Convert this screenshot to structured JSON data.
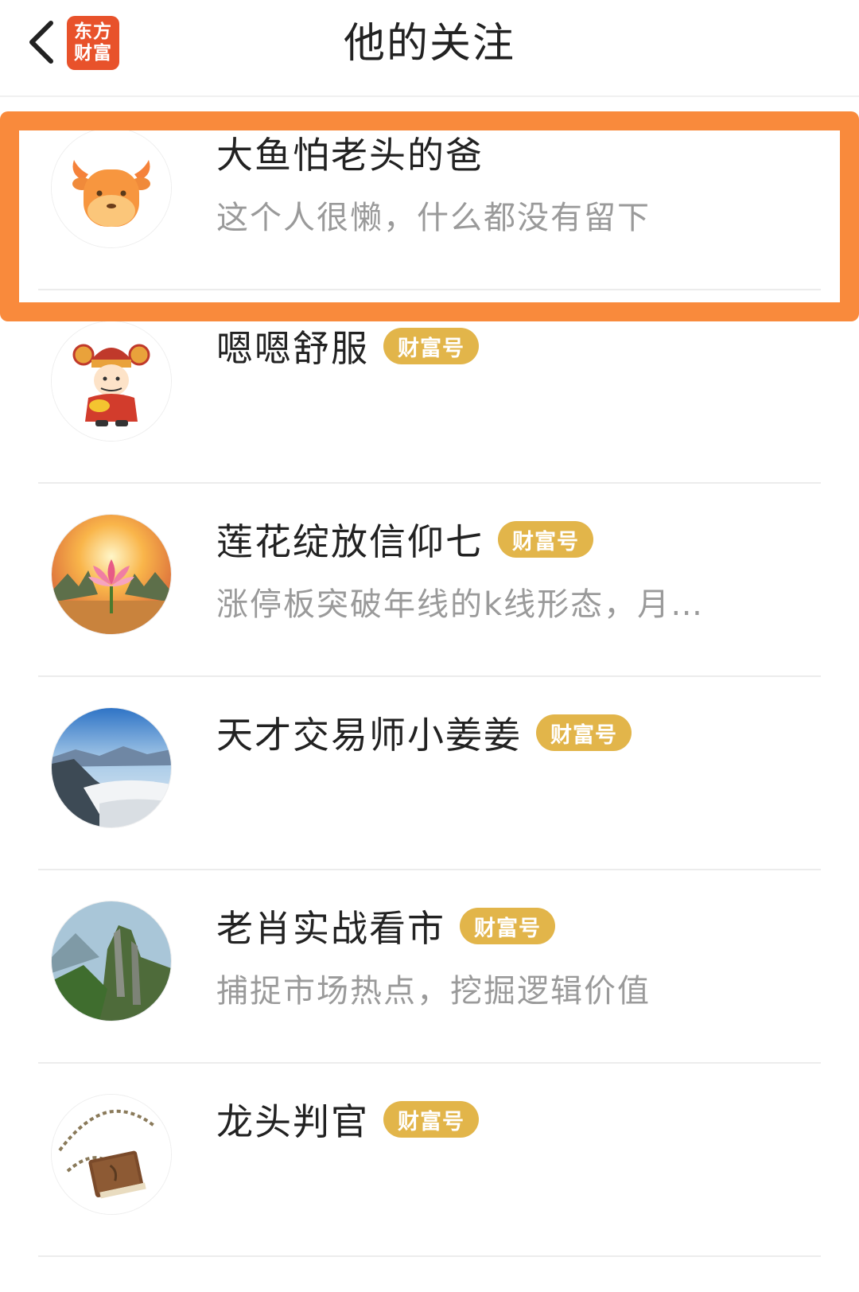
{
  "header": {
    "back_icon": "chevron-left-icon",
    "logo_line1": "东方",
    "logo_line2": "财富",
    "title": "他的关注"
  },
  "colors": {
    "highlight_border": "#f98a3c",
    "badge_bg": "#e2b54a",
    "logo_bg": "#e8522b"
  },
  "follows": [
    {
      "name": "大鱼怕老头的爸",
      "badge": "",
      "desc": "这个人很懒，什么都没有留下",
      "avatar": "cow-mascot-avatar"
    },
    {
      "name": "嗯嗯舒服",
      "badge": "财富号",
      "desc": "",
      "avatar": "god-of-wealth-avatar"
    },
    {
      "name": "莲花绽放信仰七",
      "badge": "财富号",
      "desc": "涨停板突破年线的k线形态，月…",
      "avatar": "lotus-sunset-avatar"
    },
    {
      "name": "天才交易师小姜姜",
      "badge": "财富号",
      "desc": "",
      "avatar": "mountain-clouds-avatar"
    },
    {
      "name": "老肖实战看市",
      "badge": "财富号",
      "desc": "捕捉市场热点，挖掘逻辑价值",
      "avatar": "green-mountain-avatar"
    },
    {
      "name": "龙头判官",
      "badge": "财富号",
      "desc": "",
      "avatar": "necklace-book-avatar"
    }
  ]
}
